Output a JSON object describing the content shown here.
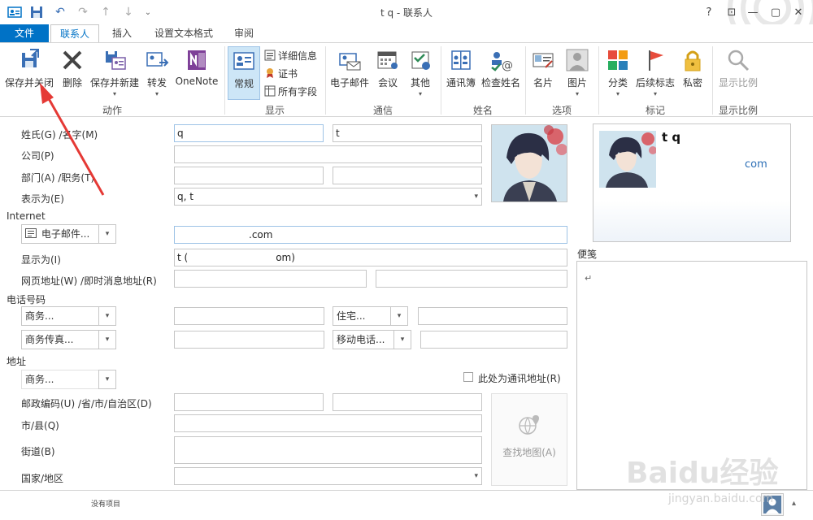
{
  "window": {
    "title": "t q - 联系人",
    "help": "?",
    "ribbon_display": "⊡",
    "minimize": "—",
    "restore": "▢",
    "close": "✕"
  },
  "tabs": [
    {
      "label": "文件"
    },
    {
      "label": "联系人"
    },
    {
      "label": "插入"
    },
    {
      "label": "设置文本格式"
    },
    {
      "label": "审阅"
    }
  ],
  "ribbon": {
    "actions": {
      "save_close": "保存并关闭",
      "delete": "删除",
      "save_new": "保存并新建",
      "forward": "转发",
      "onenote": "OneNote",
      "group_label": "动作"
    },
    "show": {
      "general": "常规",
      "details": "详细信息",
      "certificates": "证书",
      "all_fields": "所有字段",
      "group_label": "显示"
    },
    "communicate": {
      "email": "电子邮件",
      "meeting": "会议",
      "more": "其他",
      "group_label": "通信"
    },
    "names": {
      "address_book": "通讯簿",
      "check_names": "检查姓名",
      "group_label": "姓名"
    },
    "options": {
      "business_card": "名片",
      "picture": "图片",
      "group_label": "选项"
    },
    "tags": {
      "categorize": "分类",
      "follow_up": "后续标志",
      "private": "私密",
      "group_label": "标记"
    },
    "zoom": {
      "zoom": "显示比例",
      "group_label": "显示比例"
    }
  },
  "form": {
    "labels": {
      "name": "姓氏(G)  /名字(M)",
      "company": "公司(P)",
      "department": "部门(A)  /职务(T)",
      "file_as": "表示为(E)",
      "internet": "Internet",
      "display_as": "显示为(I)",
      "web_im": "网页地址(W)  /即时消息地址(R)",
      "phone_section": "电话号码",
      "address_section": "地址",
      "postal_state": "邮政编码(U)  /省/市/自治区(D)",
      "city": "市/县(Q)",
      "street": "街道(B)",
      "country": "国家/地区",
      "mailing_address": "此处为通讯地址(R)",
      "map": "查找地图(A)",
      "notes": "便笺"
    },
    "values": {
      "last_name": "q",
      "first_name": "t",
      "company": "",
      "department": "",
      "job_title": "",
      "file_as": "q, t",
      "email": ".com",
      "display_as_start": "t (",
      "display_as_end": "om)",
      "web": "",
      "im": "",
      "notes_mark": "↵"
    },
    "selectors": {
      "email_type": "电子邮件...",
      "phone1": "商务...",
      "phone2": "住宅...",
      "phone3": "商务传真...",
      "phone4": "移动电话...",
      "address_type": "商务..."
    }
  },
  "business_card": {
    "name": "t q",
    "email_end": "com"
  },
  "status": {
    "text": "没有项目"
  },
  "watermark": {
    "brand": "Baidu经验",
    "url": "jingyan.baidu.com"
  },
  "colors": {
    "accent": "#0072c6",
    "arrow": "#e53935",
    "selected_button": "#cde6f7"
  }
}
